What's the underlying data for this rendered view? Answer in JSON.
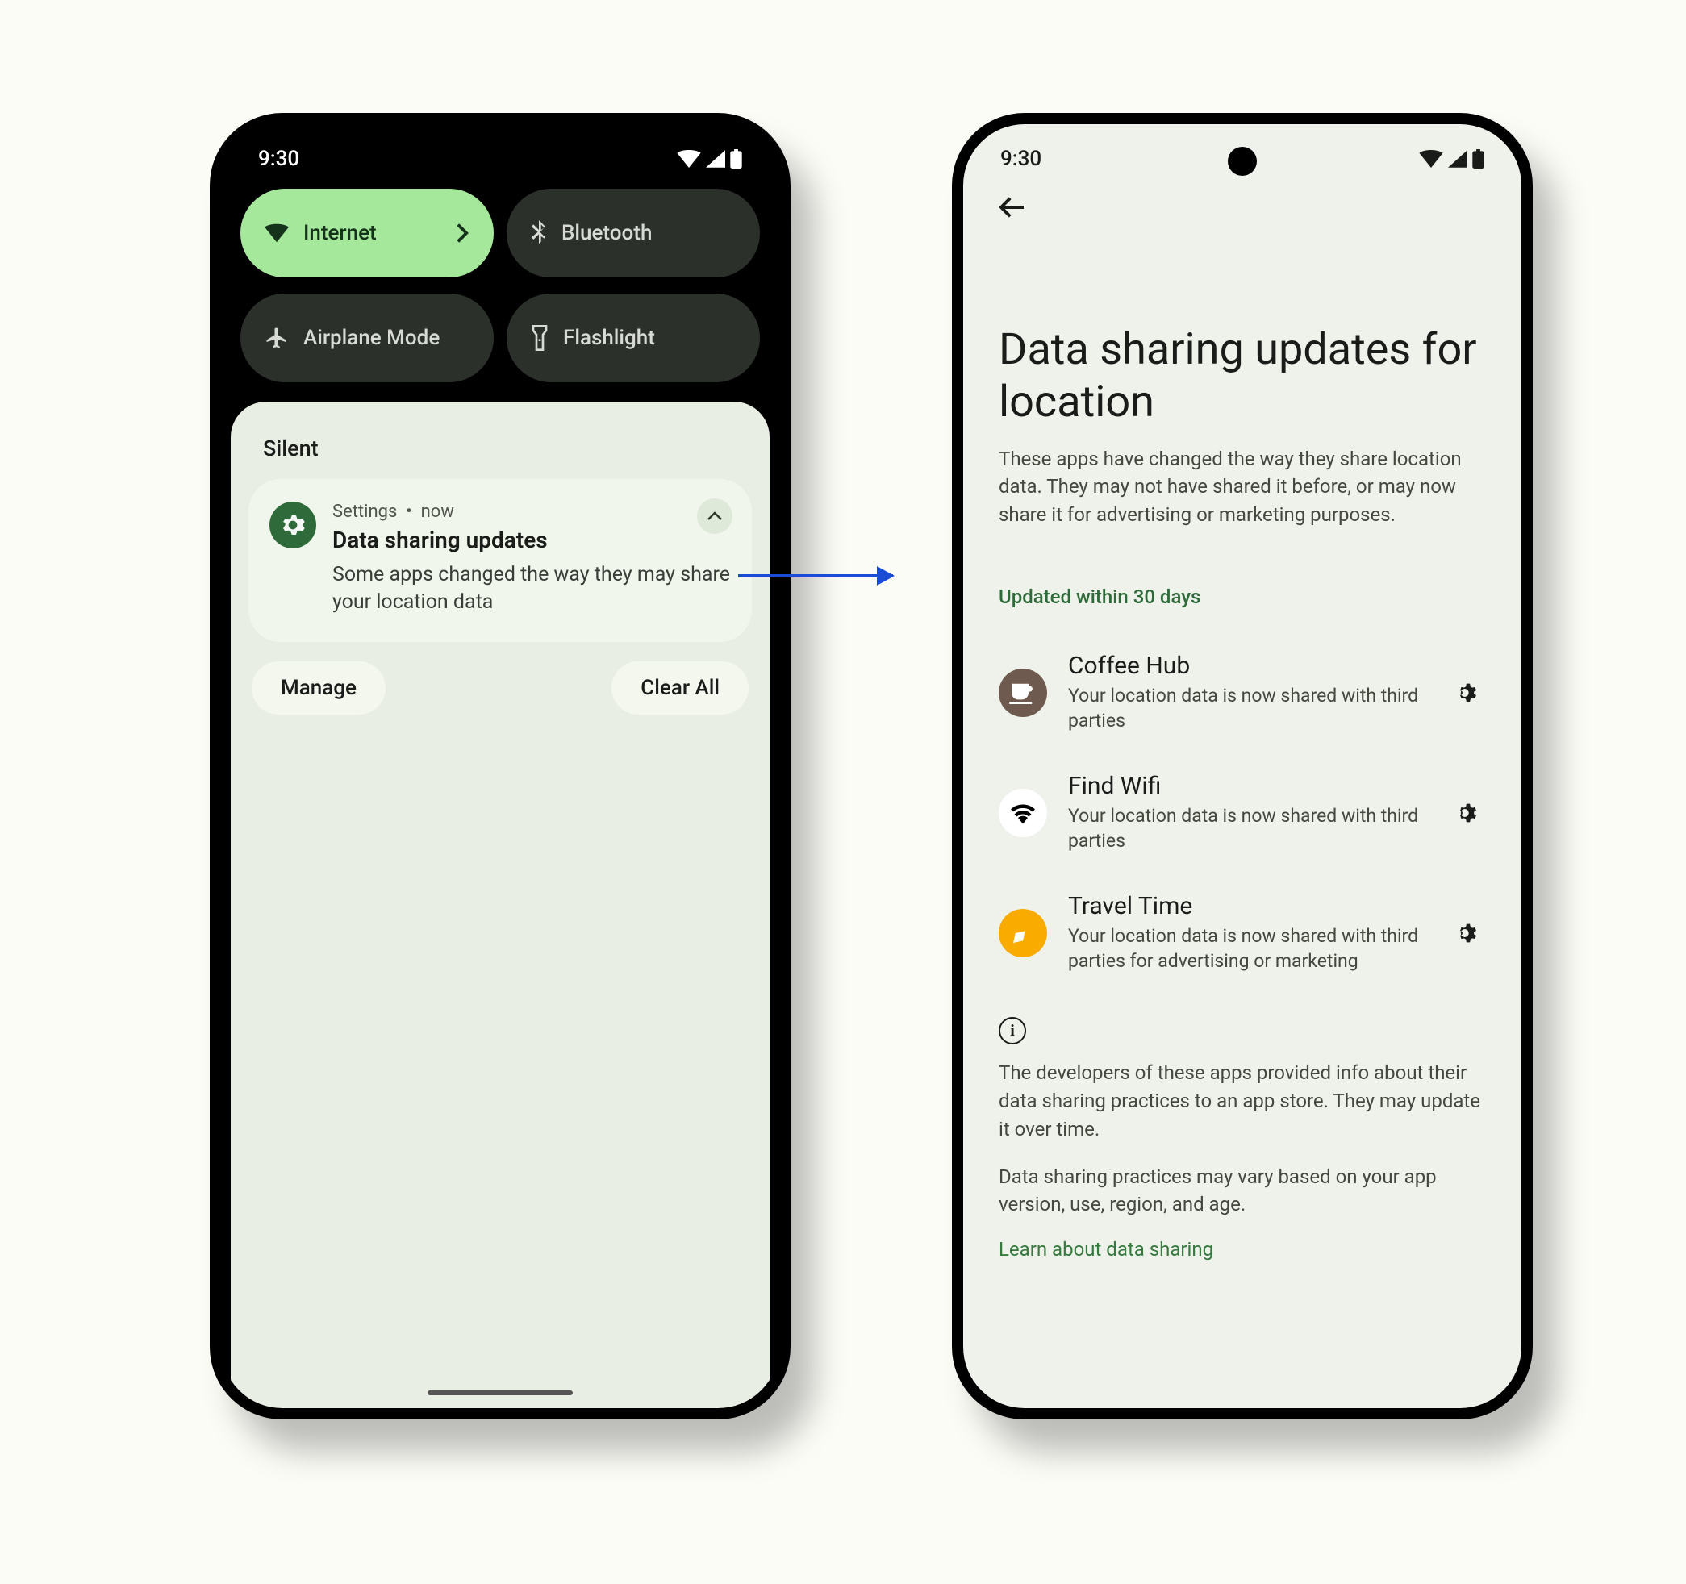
{
  "statusbar": {
    "time": "9:30"
  },
  "qs": {
    "internet": "Internet",
    "bluetooth": "Bluetooth",
    "airplane": "Airplane Mode",
    "flashlight": "Flashlight"
  },
  "shade": {
    "silent": "Silent",
    "manage": "Manage",
    "clear_all": "Clear All"
  },
  "notif": {
    "app": "Settings",
    "sep": "•",
    "time": "now",
    "title": "Data sharing updates",
    "text": "Some apps changed the way they may share your location data"
  },
  "page": {
    "title": "Data sharing updates for location",
    "subtitle": "These apps have changed the way they share location data. They may not have shared it before, or may now share it for advertising or marketing purposes.",
    "section": "Updated within 30 days",
    "apps": [
      {
        "name": "Coffee Hub",
        "desc": "Your location data is now shared with third parties"
      },
      {
        "name": "Find Wifi",
        "desc": "Your location data is now shared with third parties"
      },
      {
        "name": "Travel Time",
        "desc": "Your location data is now shared with third parties for advertising or marketing"
      }
    ],
    "info1": "The developers of these apps provided info about their data sharing practices to an app store. They may update it over time.",
    "info2": "Data sharing practices may vary based on your app version, use, region, and age.",
    "learn": "Learn about data sharing"
  }
}
